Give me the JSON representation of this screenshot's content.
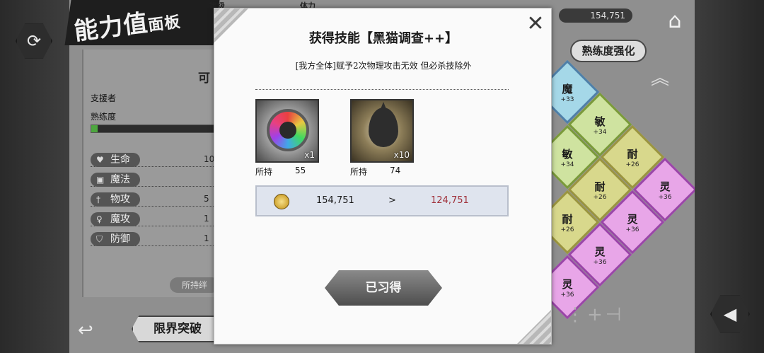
{
  "header": {
    "title_main": "能力值",
    "title_small": "面板",
    "level_label": "等级",
    "stamina_label": "体力",
    "currency_display": "154,751"
  },
  "nav": {
    "mastery_button": "熟练度强化"
  },
  "left_panel": {
    "heading": "可",
    "role_label": "支援者",
    "mastery_label": "熟练度",
    "mastery_progress": 0.05,
    "stats": [
      {
        "label": "生命",
        "value": "10",
        "icon": "heart-icon"
      },
      {
        "label": "魔法",
        "value": "",
        "icon": "magic-icon"
      },
      {
        "label": "物攻",
        "value": "5",
        "icon": "sword-icon"
      },
      {
        "label": "魔攻",
        "value": "1",
        "icon": "staff-icon"
      },
      {
        "label": "防御",
        "value": "1",
        "icon": "shield-icon"
      }
    ],
    "owned_bond": "所持绊",
    "limit_break": "限界突破"
  },
  "board": {
    "tiles": [
      {
        "name": "魔",
        "value": "+33",
        "kind": "magic"
      },
      {
        "name": "敏",
        "value": "+34",
        "kind": "agi"
      },
      {
        "name": "敏",
        "value": "+34",
        "kind": "agi"
      },
      {
        "name": "耐",
        "value": "+26",
        "kind": "dur"
      },
      {
        "name": "耐",
        "value": "+26",
        "kind": "dur"
      },
      {
        "name": "灵",
        "value": "+36",
        "kind": "spr"
      },
      {
        "name": "耐",
        "value": "+26",
        "kind": "dur"
      },
      {
        "name": "灵",
        "value": "+36",
        "kind": "spr"
      },
      {
        "name": "灵",
        "value": "+36",
        "kind": "spr"
      },
      {
        "name": "灵",
        "value": "+36",
        "kind": "spr"
      }
    ]
  },
  "modal": {
    "title": "获得技能【黑猫调查++】",
    "description": "[我方全体]赋予2次物理攻击无效 但必杀技除外",
    "items": [
      {
        "qty": "x1",
        "owned_label": "所持",
        "owned": "55"
      },
      {
        "qty": "x10",
        "owned_label": "所持",
        "owned": "74"
      }
    ],
    "cost": {
      "current": "154,751",
      "arrow": ">",
      "after": "124,751"
    },
    "button_label": "已习得",
    "close_symbol": "✕"
  }
}
